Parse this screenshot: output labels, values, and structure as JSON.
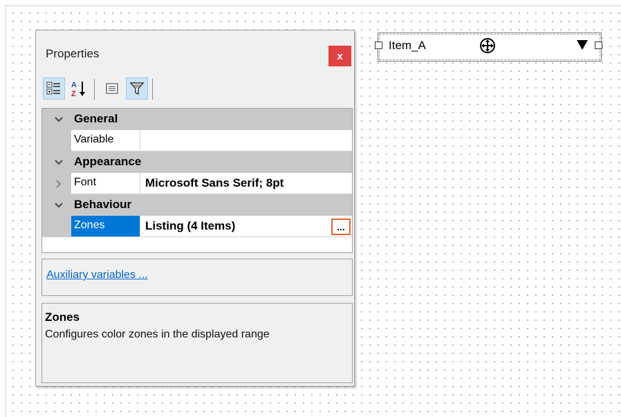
{
  "canvas_item": {
    "label": "Item_A"
  },
  "panel": {
    "title": "Properties",
    "close_label": "x",
    "toolbar": [
      "categorized-icon",
      "sort-alphabetic-icon",
      "property-pages-icon",
      "filter-icon"
    ],
    "categories": [
      {
        "label": "General",
        "properties": [
          {
            "name": "Variable",
            "value": ""
          }
        ]
      },
      {
        "label": "Appearance",
        "properties": [
          {
            "name": "Font",
            "value": "Microsoft Sans Serif; 8pt"
          }
        ]
      },
      {
        "label": "Behaviour",
        "properties": [
          {
            "name": "Zones",
            "value": "Listing (4 Items)",
            "selected": true,
            "ellipsis": "..."
          }
        ]
      }
    ],
    "aux_link": "Auxiliary variables ...",
    "help": {
      "title": "Zones",
      "text": "Configures color zones in the displayed range"
    }
  },
  "colors": {
    "selection": "#0078d7",
    "highlight_border": "#e8622c",
    "close_button": "#e04343",
    "category_band": "#c8c8c8"
  }
}
